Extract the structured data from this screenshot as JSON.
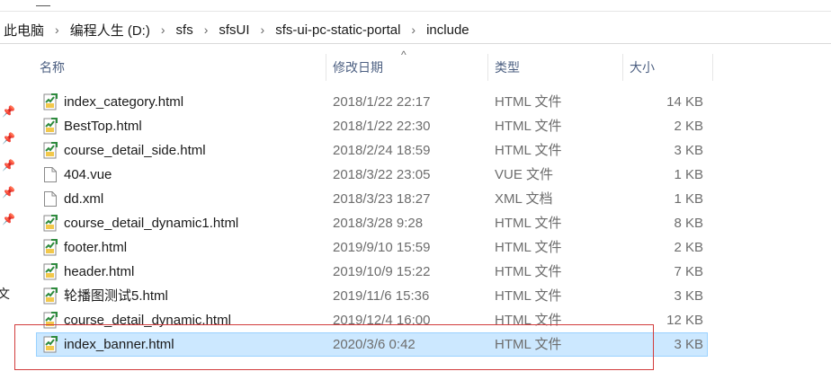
{
  "top_strip": {},
  "breadcrumb": {
    "items": [
      "此电脑",
      "编程人生 (D:)",
      "sfs",
      "sfsUI",
      "sfs-ui-pc-static-portal",
      "include"
    ],
    "separator": "›",
    "dropdown": "⌄"
  },
  "nav_pane": {
    "partial_label": "文",
    "pin_icon": "pin-icon"
  },
  "columns": {
    "name": "名称",
    "date": "修改日期",
    "type": "类型",
    "size": "大小",
    "sort_indicator": "^"
  },
  "files": [
    {
      "name": "index_category.html",
      "date": "2018/1/22 22:17",
      "type": "HTML 文件",
      "size": "14 KB",
      "icon": "html-file-icon"
    },
    {
      "name": "BestTop.html",
      "date": "2018/1/22 22:30",
      "type": "HTML 文件",
      "size": "2 KB",
      "icon": "html-file-icon"
    },
    {
      "name": "course_detail_side.html",
      "date": "2018/2/24 18:59",
      "type": "HTML 文件",
      "size": "3 KB",
      "icon": "html-file-icon"
    },
    {
      "name": "404.vue",
      "date": "2018/3/22 23:05",
      "type": "VUE 文件",
      "size": "1 KB",
      "icon": "blank-file-icon"
    },
    {
      "name": "dd.xml",
      "date": "2018/3/23 18:27",
      "type": "XML 文档",
      "size": "1 KB",
      "icon": "blank-file-icon"
    },
    {
      "name": "course_detail_dynamic1.html",
      "date": "2018/3/28 9:28",
      "type": "HTML 文件",
      "size": "8 KB",
      "icon": "html-file-icon"
    },
    {
      "name": "footer.html",
      "date": "2019/9/10 15:59",
      "type": "HTML 文件",
      "size": "2 KB",
      "icon": "html-file-icon"
    },
    {
      "name": "header.html",
      "date": "2019/10/9 15:22",
      "type": "HTML 文件",
      "size": "7 KB",
      "icon": "html-file-icon"
    },
    {
      "name": "轮播图测试5.html",
      "date": "2019/11/6 15:36",
      "type": "HTML 文件",
      "size": "3 KB",
      "icon": "html-file-icon"
    },
    {
      "name": "course_detail_dynamic.html",
      "date": "2019/12/4 16:00",
      "type": "HTML 文件",
      "size": "12 KB",
      "icon": "html-file-icon"
    },
    {
      "name": "index_banner.html",
      "date": "2020/3/6 0:42",
      "type": "HTML 文件",
      "size": "3 KB",
      "icon": "html-file-icon",
      "selected": true
    }
  ],
  "colors": {
    "selection_bg": "#cce8ff",
    "selection_border": "#99d1ff",
    "highlight_box": "#d23c3c",
    "column_header_text": "#4d6082"
  }
}
